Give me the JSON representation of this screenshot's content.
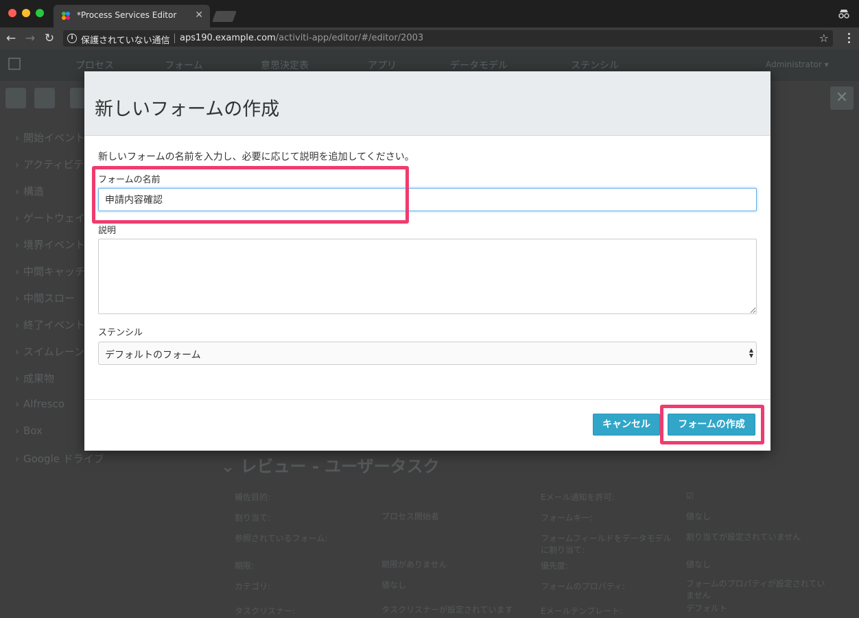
{
  "browser": {
    "tab_title": "*Process Services Editor",
    "tab_close": "✕",
    "insecure_label": "保護されていない通信",
    "url_host": "aps190.example.com",
    "url_path": "/activiti-app/editor/#/editor/2003"
  },
  "app_nav": {
    "items": [
      "プロセス",
      "フォーム",
      "意思決定表",
      "アプリ",
      "データモデル",
      "ステンシル"
    ],
    "user": "Administrator ▾"
  },
  "palette": {
    "items": [
      "開始イベント",
      "アクティビティ",
      "構造",
      "ゲートウェイ",
      "境界イベント",
      "中間キャッチ",
      "中間スロー",
      "終了イベント",
      "スイムレーン",
      "成果物",
      "Alfresco",
      "Box",
      "Google ドライブ"
    ]
  },
  "background_panel": {
    "section_title": "レビュー - ユーザータスク",
    "props_left": [
      {
        "label": "補佐目的:",
        "value": ""
      },
      {
        "label": "割り当て:",
        "value": "プロセス開始者"
      },
      {
        "label": "参照されているフォーム:",
        "value": ""
      },
      {
        "label": "期限:",
        "value": "期限がありません"
      },
      {
        "label": "カテゴリ:",
        "value": "値なし"
      },
      {
        "label": "タスクリスナー:",
        "value": "タスクリスナーが設定されています"
      }
    ],
    "props_right": [
      {
        "label": "Eメール通知を許可:",
        "value": "☑"
      },
      {
        "label": "フォームキー:",
        "value": "値なし"
      },
      {
        "label": "フォームフィールドをデータモデルに割り当て:",
        "value": "割り当てが設定されていません"
      },
      {
        "label": "優先度:",
        "value": "値なし"
      },
      {
        "label": "フォームのプロパティ:",
        "value": "フォームのプロパティが設定されていません"
      },
      {
        "label": "Eメールテンプレート:",
        "value": "デフォルト"
      }
    ]
  },
  "modal": {
    "title": "新しいフォームの作成",
    "intro": "新しいフォームの名前を入力し、必要に応じて説明を追加してください。",
    "name_label": "フォームの名前",
    "name_value": "申請内容確認",
    "description_label": "説明",
    "description_value": "",
    "stencil_label": "ステンシル",
    "stencil_value": "デフォルトのフォーム",
    "cancel_label": "キャンセル",
    "create_label": "フォームの作成"
  },
  "colors": {
    "primary_button": "#31a6c8",
    "highlight": "#f03b6e",
    "focus": "#66afe9"
  }
}
